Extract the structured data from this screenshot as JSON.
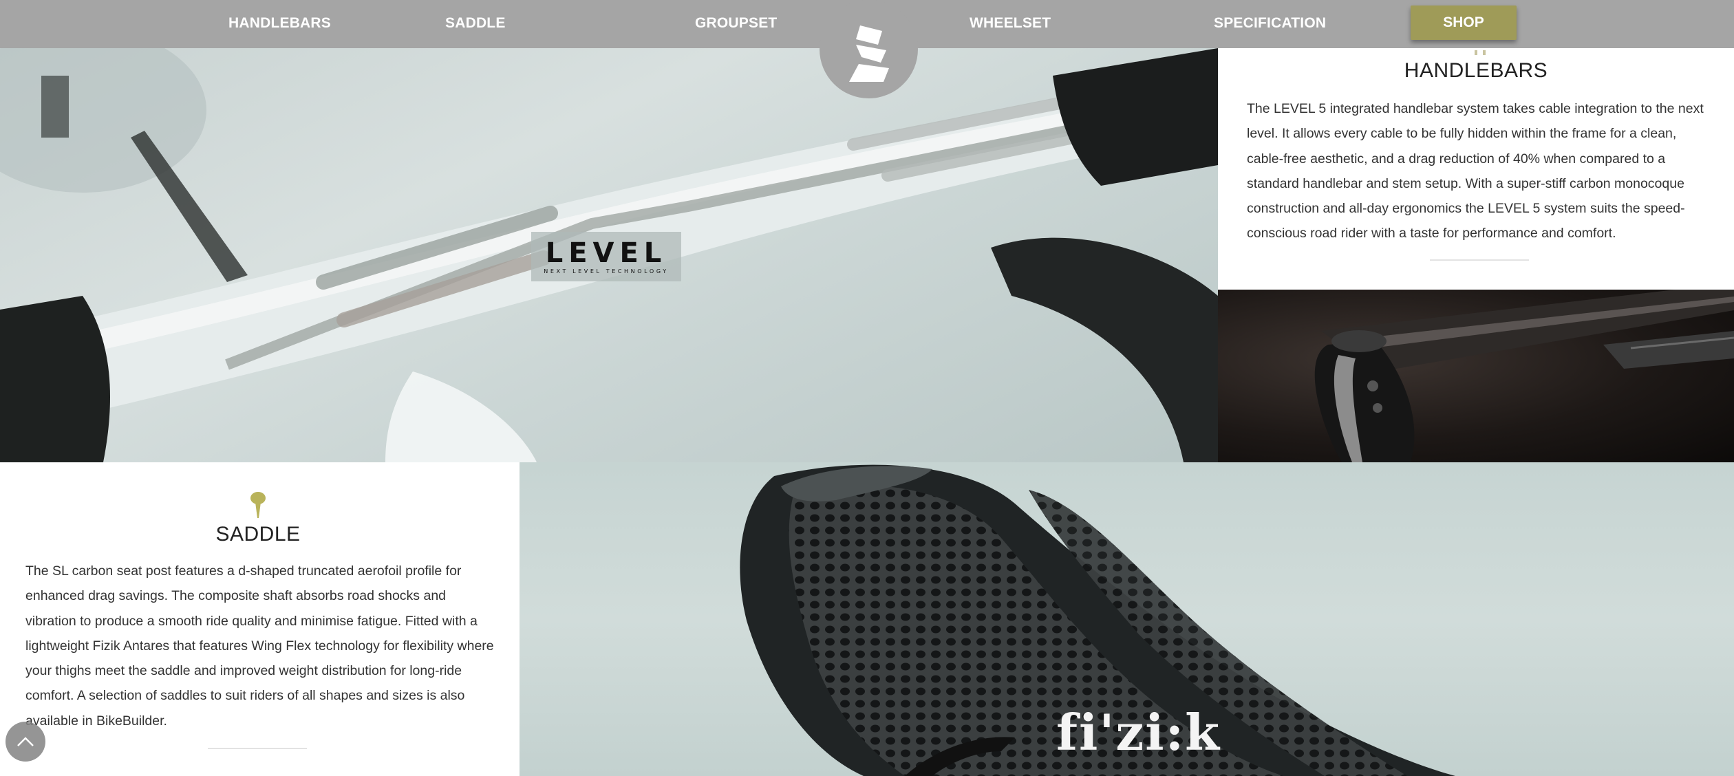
{
  "nav": {
    "items": [
      {
        "label": "HANDLEBARS"
      },
      {
        "label": "SADDLE"
      },
      {
        "label": "GROUPSET"
      },
      {
        "label": "WHEELSET"
      },
      {
        "label": "SPECIFICATION"
      }
    ],
    "shop_label": "SHOP",
    "logo_icon": "brand-logo-icon"
  },
  "hero_handlebar": {
    "badge_word": "LEVEL",
    "badge_tagline": "NEXT LEVEL TECHNOLOGY"
  },
  "handlebars": {
    "title": "HANDLEBARS",
    "text": "The LEVEL 5 integrated handlebar system takes cable integration to the next level. It allows every cable to be fully hidden within the frame for a clean, cable-free aesthetic, and a drag reduction of 40% when compared to a standard handlebar and stem setup. With a super-stiff carbon monocoque construction and all-day ergonomics the LEVEL 5 system suits the speed-conscious road rider with a taste for performance and comfort."
  },
  "saddle": {
    "icon": "seatpost-pin-icon",
    "title": "SADDLE",
    "text": "The SL carbon seat post features a d-shaped truncated aerofoil profile for enhanced drag savings. The composite shaft absorbs road shocks and vibration to produce a smooth ride quality and minimise fatigue. Fitted with a lightweight Fizik Antares that features Wing Flex technology for flexibility where your thighs meet the saddle and improved weight distribution for long-ride comfort. A selection of saddles to suit riders of all shapes and sizes is also available in BikeBuilder."
  },
  "saddle_image": {
    "brand_logo": "fi'zi:k"
  },
  "colors": {
    "nav_background": "#a5a5a5",
    "shop_button": "#9f9b58",
    "accent_gold": "#b9b35a"
  },
  "scroll_top": {
    "icon": "chevron-up-icon"
  }
}
